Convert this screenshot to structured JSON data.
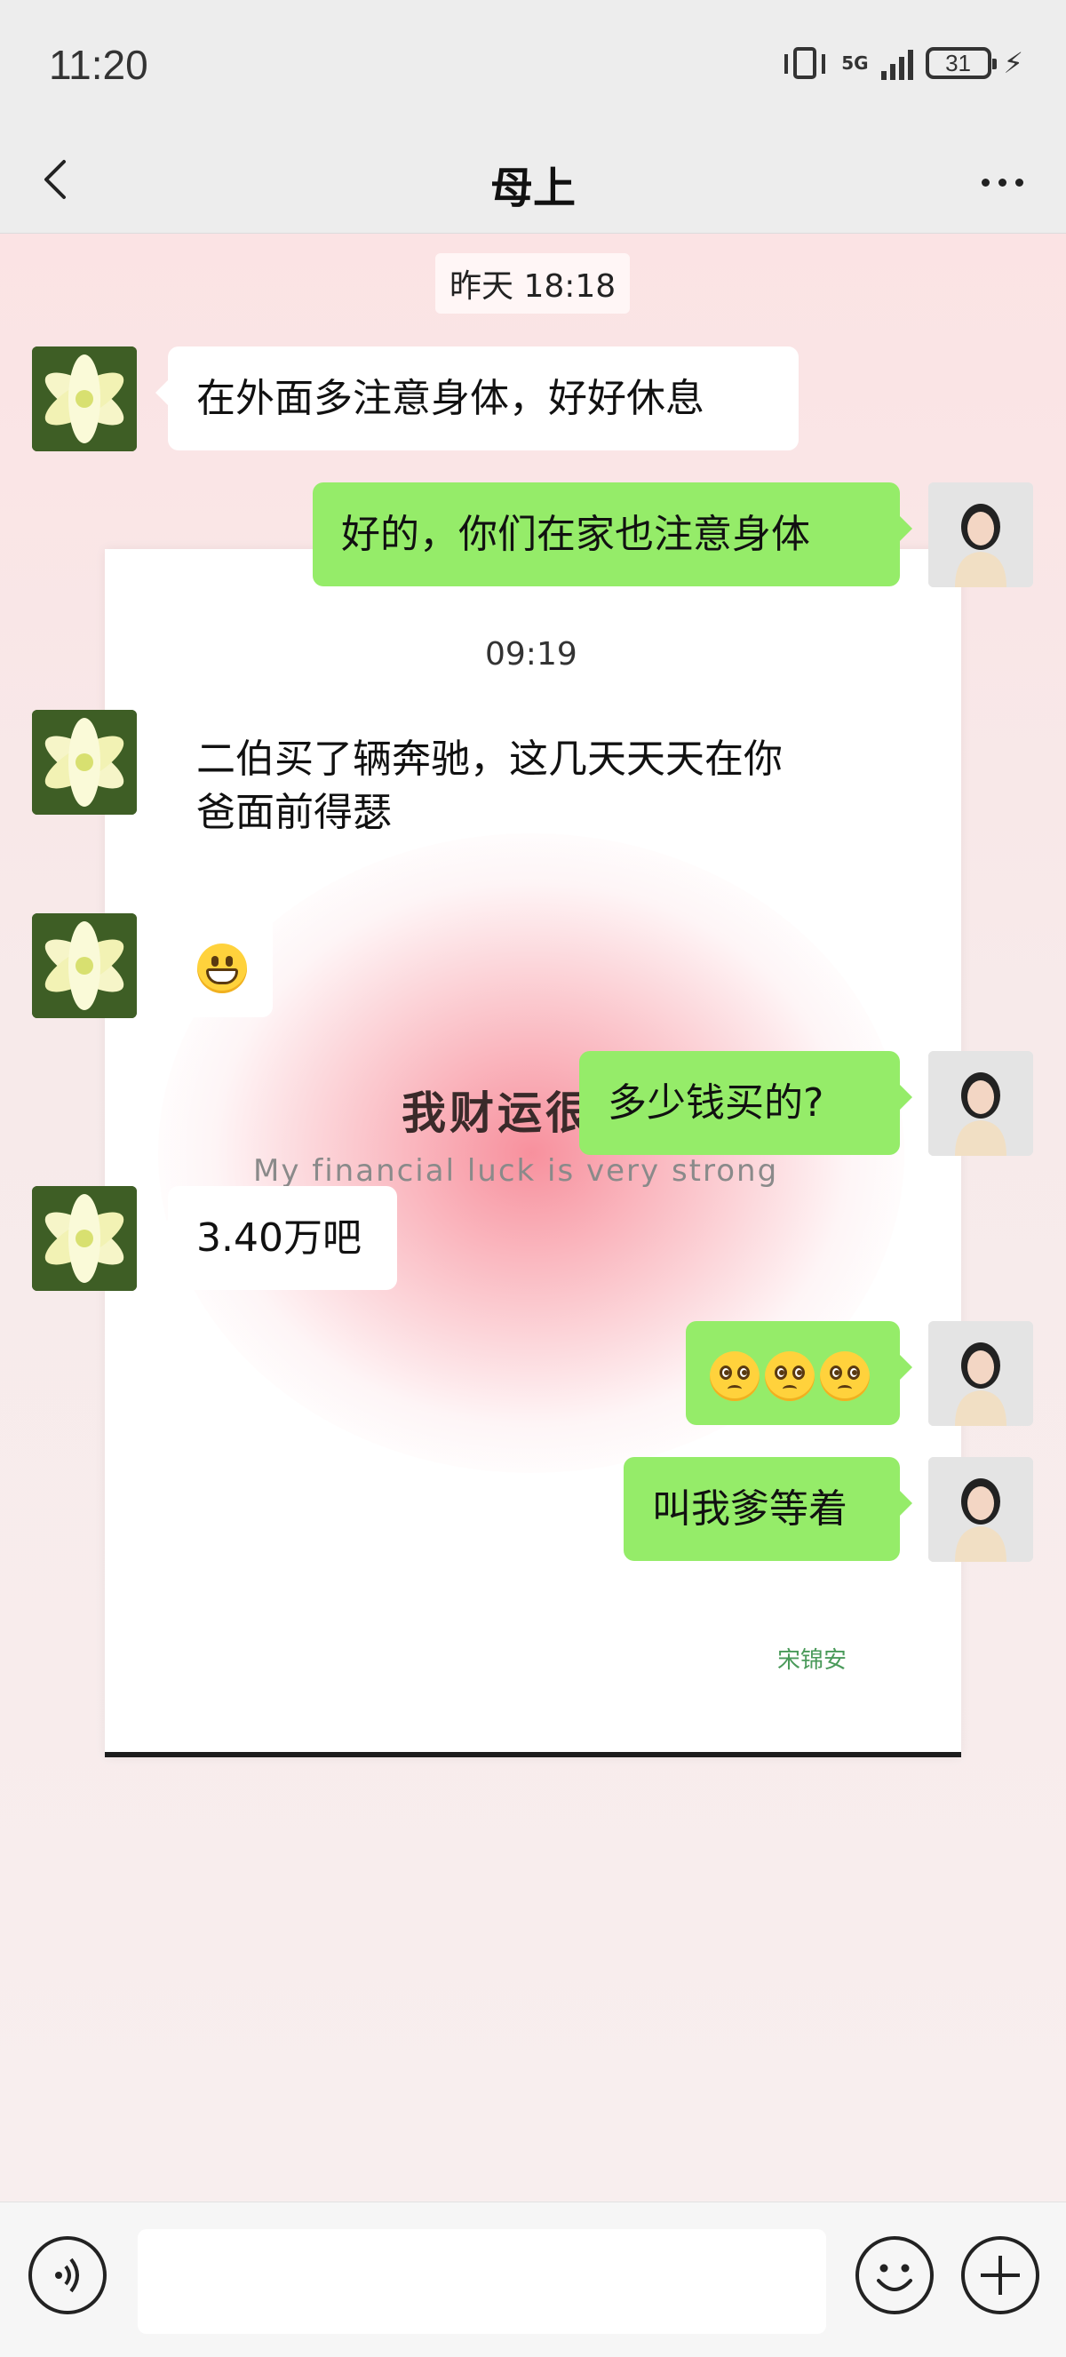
{
  "status_bar": {
    "time": "11:20",
    "network": "5G",
    "battery": "31"
  },
  "header": {
    "title": "母上"
  },
  "wallpaper": {
    "title": "我财运很",
    "subtitle": "My financial luck is very strong",
    "signature": "宋锦安"
  },
  "messages": [
    {
      "type": "timestamp",
      "text": "昨天 18:18"
    },
    {
      "type": "received",
      "text": "在外面多注意身体，好好休息"
    },
    {
      "type": "sent",
      "text": "好的，你们在家也注意身体"
    },
    {
      "type": "timestamp",
      "text": "09:19"
    },
    {
      "type": "received",
      "lines": [
        "二伯买了辆奔驰，这几天天天在你",
        "爸面前得瑟"
      ]
    },
    {
      "type": "received",
      "emoji": "grinning-face-emoji"
    },
    {
      "type": "sent",
      "text": "多少钱买的?"
    },
    {
      "type": "received",
      "text": "3.40万吧"
    },
    {
      "type": "sent",
      "emoji": "pleading-face-emoji x3"
    },
    {
      "type": "sent",
      "text": "叫我爹等着"
    }
  ],
  "input": {
    "value": ""
  },
  "colors": {
    "sent_bubble": "#95ec69",
    "received_bubble": "#ffffff",
    "bar_bg": "#ededed"
  }
}
